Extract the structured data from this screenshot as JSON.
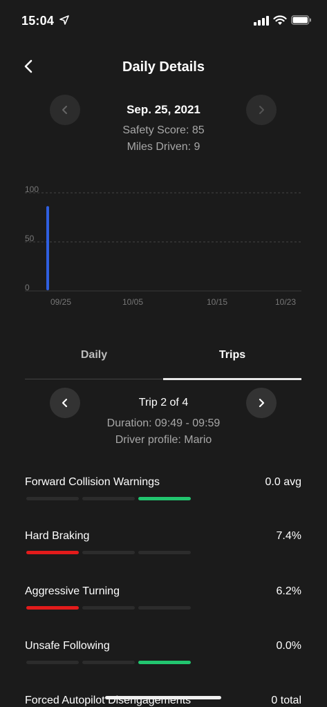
{
  "status": {
    "time": "15:04"
  },
  "header": {
    "title": "Daily Details"
  },
  "date_nav": {
    "date": "Sep. 25, 2021",
    "safety_score": "Safety Score: 85",
    "miles_driven": "Miles Driven: 9"
  },
  "chart_data": {
    "type": "bar",
    "y_ticks": [
      "100",
      "50",
      "0"
    ],
    "ylim": [
      0,
      100
    ],
    "x_tick_labels": [
      "09/25",
      "10/05",
      "10/15",
      "10/23"
    ],
    "categories": [
      "09/25"
    ],
    "values": [
      85
    ],
    "bar_color": "#2f5fe0",
    "grid": true
  },
  "tabs": {
    "daily": "Daily",
    "trips": "Trips"
  },
  "trip": {
    "title": "Trip 2 of 4",
    "duration": "Duration: 09:49 - 09:59",
    "driver": "Driver profile: Mario"
  },
  "metrics": [
    {
      "label": "Forward Collision Warnings",
      "value": "0.0 avg",
      "active_segment": 3,
      "color": "green"
    },
    {
      "label": "Hard Braking",
      "value": "7.4%",
      "active_segment": 1,
      "color": "red"
    },
    {
      "label": "Aggressive Turning",
      "value": "6.2%",
      "active_segment": 1,
      "color": "red"
    },
    {
      "label": "Unsafe Following",
      "value": "0.0%",
      "active_segment": 3,
      "color": "green"
    },
    {
      "label": "Forced Autopilot Disengagements",
      "value": "0 total"
    }
  ],
  "colors": {
    "red": "#e31b1b",
    "green": "#22c56f",
    "background": "#1b1b1b"
  }
}
